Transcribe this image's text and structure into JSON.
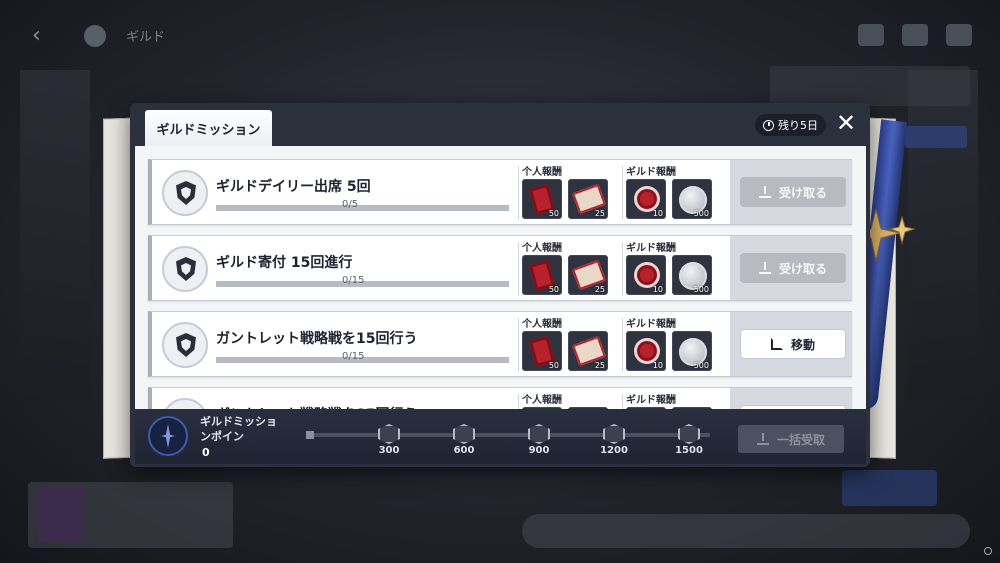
{
  "background": {
    "title": "ギルド"
  },
  "panel": {
    "tab_label": "ギルドミッション",
    "remaining": "残り5日",
    "close_symbol": "✕"
  },
  "reward_headers": {
    "personal": "个人報酬",
    "guild": "ギルド報酬"
  },
  "missions": [
    {
      "title": "ギルドデイリー出席 5回",
      "progress": "0/5",
      "progress_fraction": 0,
      "personal_rewards": [
        {
          "icon": "red-ticket-icon",
          "qty": "50"
        },
        {
          "icon": "scroll-icon",
          "qty": "25"
        }
      ],
      "guild_rewards": [
        {
          "icon": "red-medal-icon",
          "qty": "10"
        },
        {
          "icon": "silver-coin-icon",
          "qty": "500"
        }
      ],
      "action": "受け取る",
      "action_state": "disabled"
    },
    {
      "title": "ギルド寄付 15回進行",
      "progress": "0/15",
      "progress_fraction": 0,
      "personal_rewards": [
        {
          "icon": "red-ticket-icon",
          "qty": "50"
        },
        {
          "icon": "scroll-icon",
          "qty": "25"
        }
      ],
      "guild_rewards": [
        {
          "icon": "red-medal-icon",
          "qty": "10"
        },
        {
          "icon": "silver-coin-icon",
          "qty": "500"
        }
      ],
      "action": "受け取る",
      "action_state": "disabled"
    },
    {
      "title": "ガントレット戦略戦を15回行う",
      "progress": "0/15",
      "progress_fraction": 0,
      "personal_rewards": [
        {
          "icon": "red-ticket-icon",
          "qty": "50"
        },
        {
          "icon": "scroll-icon",
          "qty": "25"
        }
      ],
      "guild_rewards": [
        {
          "icon": "red-medal-icon",
          "qty": "10"
        },
        {
          "icon": "silver-coin-icon",
          "qty": "500"
        }
      ],
      "action": "移動",
      "action_state": "active"
    }
  ],
  "footer": {
    "points_label": "ギルドミッションポイン",
    "points_value": "0",
    "milestones": [
      "300",
      "600",
      "900",
      "1200",
      "1500"
    ],
    "bulk_button": "一括受取"
  },
  "colors": {
    "panel_bg": "#2c303d",
    "accent_blue": "#3c5ba8",
    "disabled_button": "#b7bac1"
  }
}
